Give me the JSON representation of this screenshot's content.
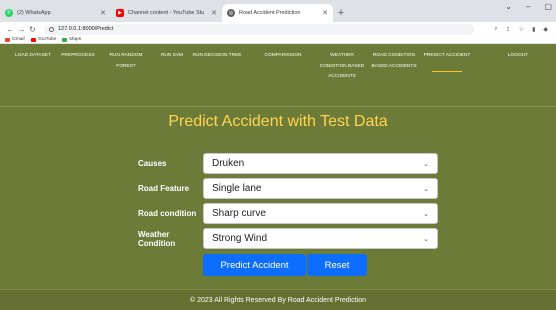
{
  "browser": {
    "tabs": [
      {
        "title": "(2) WhatsApp",
        "icon": "whatsapp-icon",
        "color": "#25d366"
      },
      {
        "title": "Channel content - YouTube Stu",
        "icon": "youtube-icon",
        "color": "#ff0000"
      },
      {
        "title": "Road Accident Prediction",
        "icon": "globe-icon",
        "color": "#5f6368"
      }
    ],
    "url": "127.0.0.1:8000/Predict",
    "bookmarks": [
      {
        "label": "Gmail",
        "icon": "gmail-icon",
        "color": "#ea4335"
      },
      {
        "label": "YouTube",
        "icon": "youtube-icon",
        "color": "#ff0000"
      },
      {
        "label": "Maps",
        "icon": "maps-icon",
        "color": "#34a853"
      }
    ]
  },
  "nav": {
    "items": [
      {
        "label": "LOAD DATASET"
      },
      {
        "label": "PREPROCESS"
      },
      {
        "label": "RUN RANDOM FOREST"
      },
      {
        "label": "RUN SVM"
      },
      {
        "label": "RUN DECISION TREE"
      },
      {
        "label": "COMPARISSION"
      },
      {
        "label": "WEATHER CONDITION BASED ACCIDENTS"
      },
      {
        "label": "ROAD CONDITION BASED ACCIDENTS"
      },
      {
        "label": "PREDICT ACCIDENT",
        "active": true
      },
      {
        "label": "LOGOUT"
      }
    ]
  },
  "page": {
    "title": "Predict Accident with Test Data"
  },
  "form": {
    "fields": [
      {
        "label": "Causes",
        "value": "Druken"
      },
      {
        "label": "Road Feature",
        "value": "Single lane"
      },
      {
        "label": "Road condition",
        "value": "Sharp curve"
      },
      {
        "label": "Weather Condition",
        "value": "Strong Wind"
      }
    ],
    "predict_label": "Predict Accident",
    "reset_label": "Reset"
  },
  "footer": {
    "text": "© 2023 All Rights Reserved By Road Accident Prediction"
  },
  "colors": {
    "background": "#6d7b39",
    "title": "#ffd54f",
    "button": "#0d6efd",
    "active_underline": "#f6c623"
  }
}
